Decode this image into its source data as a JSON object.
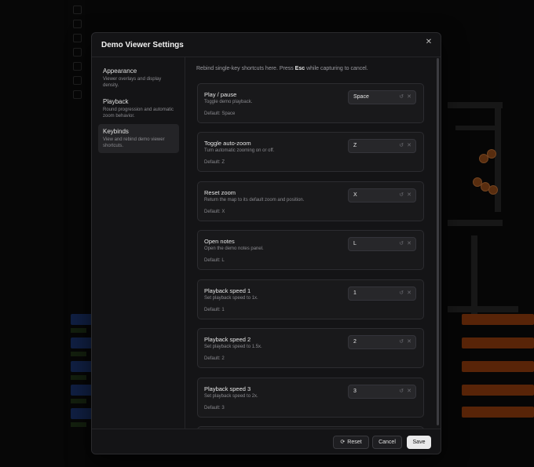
{
  "modal": {
    "title": "Demo Viewer Settings",
    "close_icon": "close-icon"
  },
  "sidebar": {
    "items": [
      {
        "label": "Appearance",
        "description": "Viewer overlays and display density."
      },
      {
        "label": "Playback",
        "description": "Round progression and automatic zoom behavior."
      },
      {
        "label": "Keybinds",
        "description": "View and rebind demo viewer shortcuts."
      }
    ],
    "active": "Keybinds"
  },
  "content": {
    "intro_prefix": "Rebind single-key shortcuts here. Press ",
    "intro_key": "Esc",
    "intro_suffix": " while capturing to cancel.",
    "keybinds": [
      {
        "title": "Play / pause",
        "description": "Toggle demo playback.",
        "default": "Default: Space",
        "key": "Space"
      },
      {
        "title": "Toggle auto-zoom",
        "description": "Turn automatic zooming on or off.",
        "default": "Default: Z",
        "key": "Z"
      },
      {
        "title": "Reset zoom",
        "description": "Return the map to its default zoom and position.",
        "default": "Default: X",
        "key": "X"
      },
      {
        "title": "Open notes",
        "description": "Open the demo notes panel.",
        "default": "Default: L",
        "key": "L"
      },
      {
        "title": "Playback speed 1",
        "description": "Set playback speed to 1x.",
        "default": "Default: 1",
        "key": "1"
      },
      {
        "title": "Playback speed 2",
        "description": "Set playback speed to 1.5x.",
        "default": "Default: 2",
        "key": "2"
      },
      {
        "title": "Playback speed 3",
        "description": "Set playback speed to 2x.",
        "default": "Default: 3",
        "key": "3"
      }
    ]
  },
  "footer": {
    "reset_label": "Reset",
    "cancel_label": "Cancel",
    "save_label": "Save"
  },
  "colors": {
    "accent_save": "#e9e9ea",
    "modal_bg": "#141416",
    "card_bg": "#19191b"
  }
}
